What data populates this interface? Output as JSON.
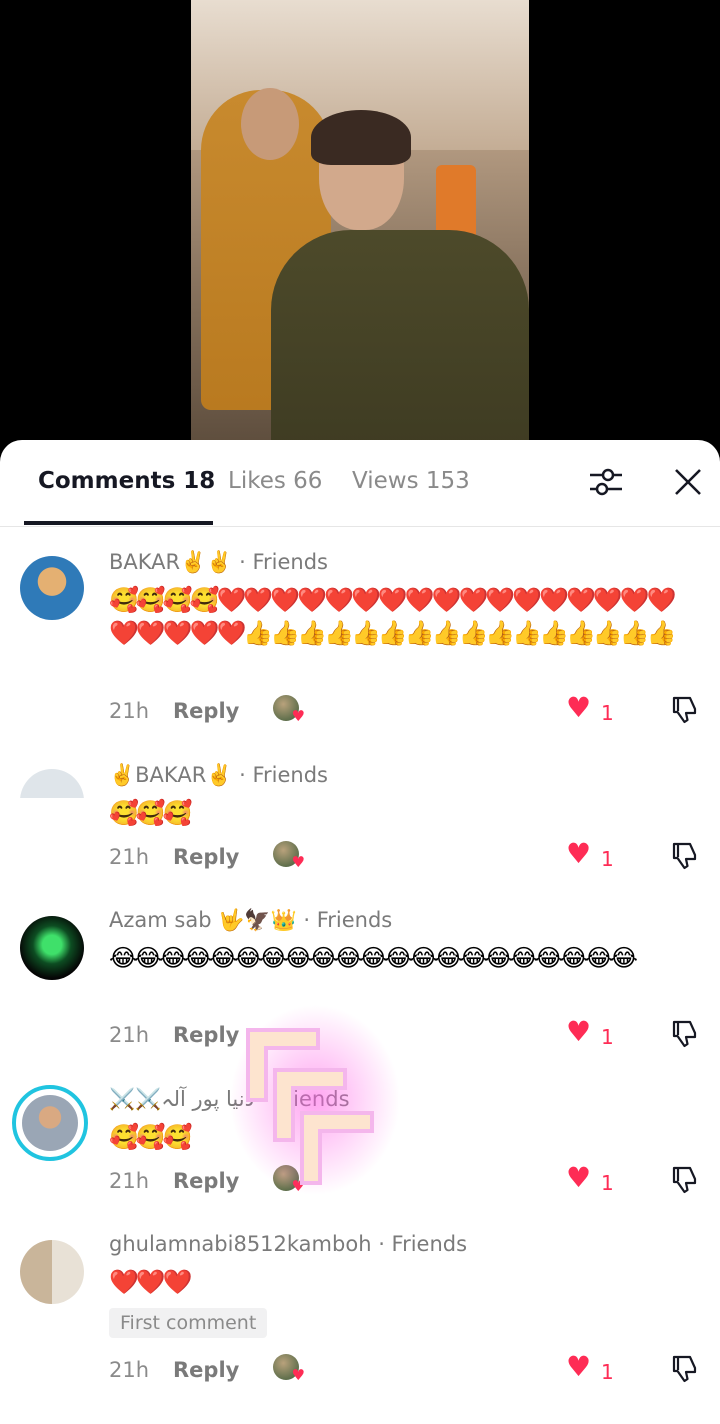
{
  "tabs": {
    "comments_label": "Comments 18",
    "likes_label": "Likes 66",
    "views_label": "Views 153"
  },
  "comments": [
    {
      "author": "BAKAR✌️✌️",
      "relation": "· Friends",
      "text": "🥰🥰🥰🥰❤️❤️❤️❤️❤️❤️❤️❤️❤️❤️❤️❤️❤️❤️❤️❤️❤️❤️❤️❤️❤️❤️👍👍👍👍👍👍👍👍👍👍👍👍👍👍👍👍",
      "time": "21h",
      "reply": "Reply",
      "likes": "1"
    },
    {
      "author": "✌️BAKAR✌️",
      "relation": "· Friends",
      "text": "🥰🥰🥰",
      "time": "21h",
      "reply": "Reply",
      "likes": "1"
    },
    {
      "author": "Azam sab 🤟🦅👑",
      "relation": "· Friends",
      "text": "😂😂😂😂😂😂😂😂😂😂😂😂😂😂😂😂😂😂😂😂😂",
      "time": "21h",
      "reply": "Reply",
      "likes": "1"
    },
    {
      "author": "⚔️⚔️دنیا پور آلہ",
      "relation": "· Friends",
      "text": "🥰🥰🥰",
      "time": "21h",
      "reply": "Reply",
      "likes": "1"
    },
    {
      "author": "ghulamnabi8512kamboh",
      "relation": "· Friends",
      "text": "❤️❤️❤️",
      "badge": "First comment",
      "time": "21h",
      "reply": "Reply",
      "likes": "1"
    }
  ],
  "colors": {
    "accent": "#fe2c55",
    "story_ring": "#20c4e0",
    "text_primary": "#161823",
    "text_secondary": "#8a8a8a"
  },
  "icons": {
    "filter": "sliders-icon",
    "close": "close-icon",
    "like": "heart-icon",
    "dislike": "thumbs-down-icon"
  }
}
